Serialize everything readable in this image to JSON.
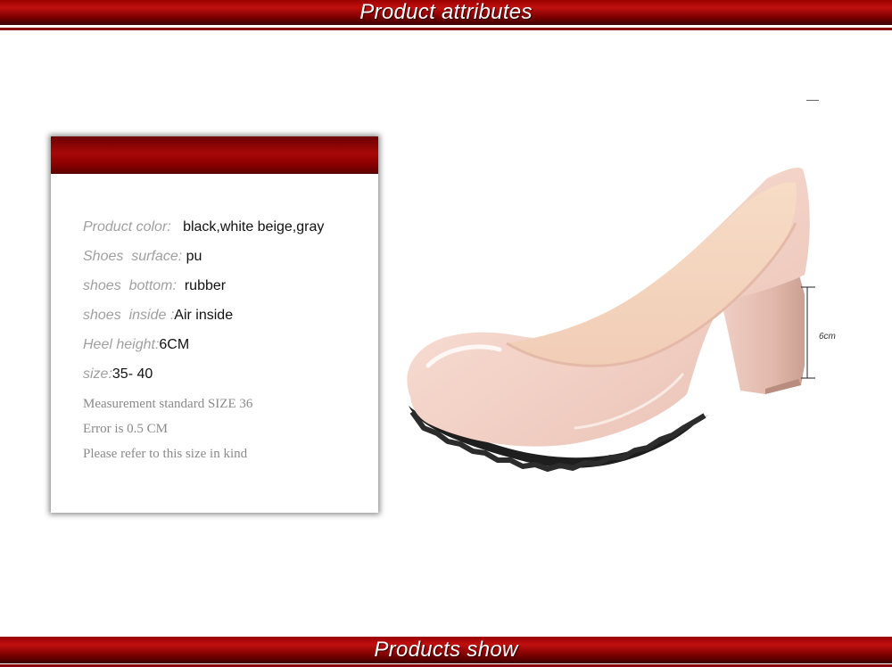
{
  "header": {
    "title": "Product attributes"
  },
  "footer": {
    "title": "Products show"
  },
  "attributes": [
    {
      "label": "Product color:",
      "value": "black,white beige,gray"
    },
    {
      "label": "Shoes  surface:",
      "value": "pu"
    },
    {
      "label": "shoes  bottom:",
      "value": "rubber"
    },
    {
      "label": "shoes  inside :",
      "value": "Air inside"
    },
    {
      "label": "Heel height:",
      "value": "6CM"
    },
    {
      "label": "size:",
      "value": "35- 40"
    }
  ],
  "notes": [
    "Measurement standard SIZE 36",
    "Error is 0.5 CM",
    "Please refer to this size in kind"
  ],
  "heel_label": "6cm"
}
